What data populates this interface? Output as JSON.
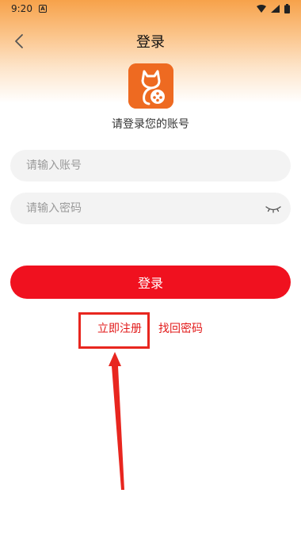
{
  "status_bar": {
    "time": "9:20",
    "badge": "A"
  },
  "header": {
    "title": "登录"
  },
  "logo": {
    "icon": "app-logo-icon",
    "color": "#ee6a21"
  },
  "subtitle": "请登录您的账号",
  "form": {
    "account_placeholder": "请输入账号",
    "account_value": "",
    "password_placeholder": "请输入密码",
    "password_value": ""
  },
  "buttons": {
    "login": "登录"
  },
  "links": {
    "register": "立即注册",
    "forgot_password": "找回密码"
  },
  "colors": {
    "accent": "#f0111f",
    "link": "#e21a1a",
    "header_gradient_top": "#f7a24a",
    "annotation": "#e8261f"
  }
}
